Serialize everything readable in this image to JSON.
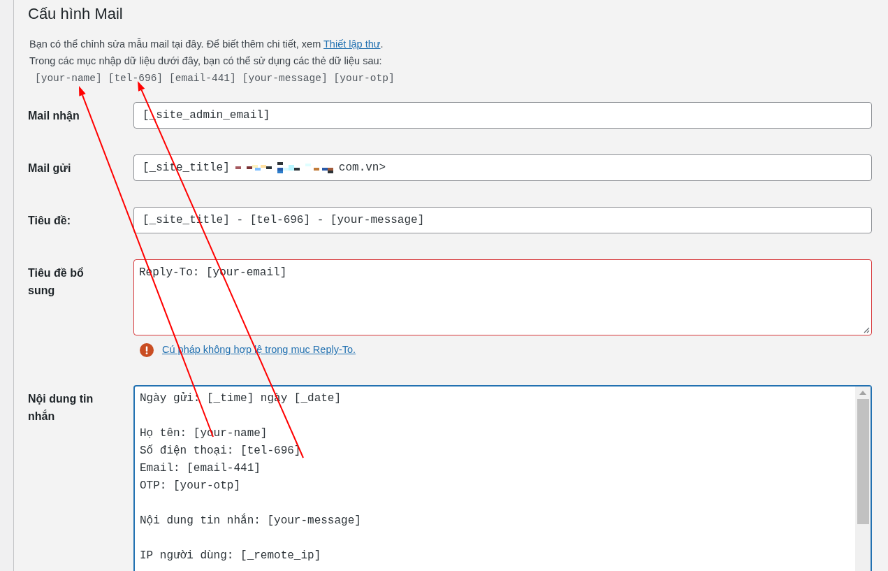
{
  "section": {
    "title": "Cấu hình Mail"
  },
  "description": {
    "text": "Bạn có thể chỉnh sửa mẫu mail tại đây. Để biết thêm chi tiết, xem ",
    "link": "Thiết lập thư",
    "end": ".",
    "line2": "Trong các mục nhập dữ liệu dưới đây, bạn có thể sử dụng các thẻ dữ liệu sau:"
  },
  "tags": [
    "[your-name]",
    "[tel-696]",
    "[email-441]",
    "[your-message]",
    "[your-otp]"
  ],
  "fields": [
    {
      "kind": "input",
      "label": "Mail nhận",
      "value": "[_site_admin_email]",
      "invalid": false,
      "focused": false
    },
    {
      "kind": "input",
      "label": "Mail gửi",
      "value": "[_site_title]",
      "value_end": "com.vn>",
      "redacted": true,
      "invalid": false,
      "focused": false
    },
    {
      "kind": "input",
      "label": "Tiêu đề:",
      "value": "[_site_title] - [tel-696] - [your-message]",
      "invalid": false,
      "focused": false
    },
    {
      "kind": "textarea",
      "label": "Tiêu đề bổ sung",
      "lines": [
        "Reply-To: [your-email]"
      ],
      "invalid": true,
      "focused": false,
      "error": "Cú pháp không hợp lệ trong mục Reply-To."
    },
    {
      "kind": "body",
      "label": "Nội dung tin nhắn",
      "paragraphs": [
        [
          "Ngày gửi: [_time] ngày [_date]"
        ],
        [
          "Họ tên: [your-name]",
          "Số điện thoại: [tel-696]",
          "Email: [email-441]",
          "OTP: [your-otp]"
        ],
        [
          "Nội dung tin nhắn: [your-message]"
        ],
        [
          "IP người dùng: [_remote_ip]"
        ]
      ],
      "invalid": false,
      "focused": true
    }
  ]
}
